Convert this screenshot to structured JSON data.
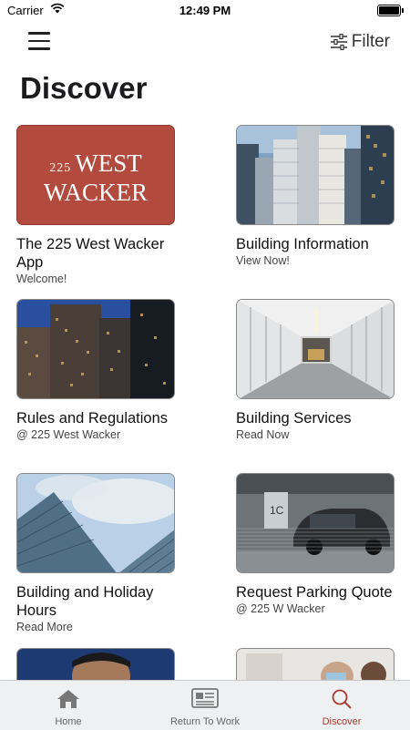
{
  "status": {
    "carrier": "Carrier",
    "time": "12:49 PM"
  },
  "header": {
    "filter_label": "Filter"
  },
  "page": {
    "title": "Discover"
  },
  "logo": {
    "line1_number": "225",
    "line1_word": "WEST",
    "line2_word": "WACKER"
  },
  "cards": [
    {
      "title": "The 225 West Wacker App",
      "subtitle": "Welcome!"
    },
    {
      "title": "Building Information",
      "subtitle": "View Now!"
    },
    {
      "title": "Rules and Regulations",
      "subtitle": "@ 225 West Wacker"
    },
    {
      "title": "Building Services",
      "subtitle": "Read Now"
    },
    {
      "title": "Building and Holiday Hours",
      "subtitle": "Read More"
    },
    {
      "title": "Request Parking Quote",
      "subtitle": "@ 225 W Wacker"
    }
  ],
  "tabs": [
    {
      "label": "Home",
      "icon": "home-icon"
    },
    {
      "label": "Return To Work",
      "icon": "newspaper-icon"
    },
    {
      "label": "Discover",
      "icon": "search-icon"
    }
  ],
  "colors": {
    "accent": "#a83a30",
    "logo_bg": "#b24a3d",
    "tabbar_bg": "#eef0f1"
  }
}
